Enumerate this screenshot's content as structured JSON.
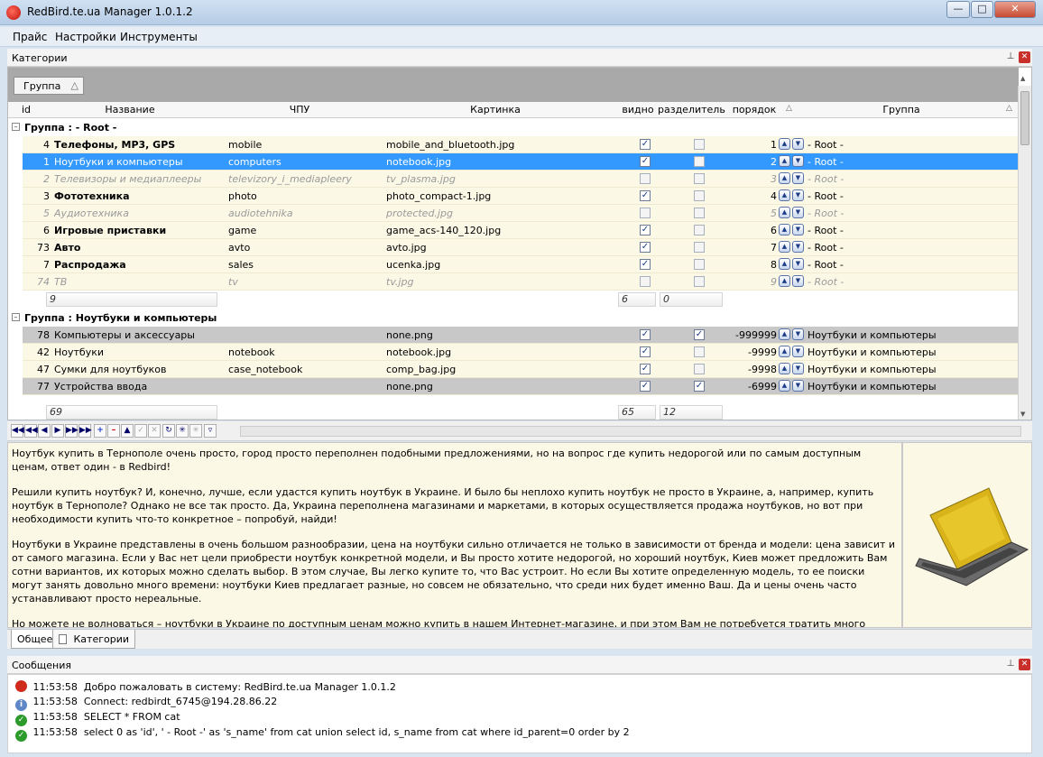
{
  "window": {
    "title": "RedBird.te.ua Manager 1.0.1.2"
  },
  "menu": [
    "Прайс",
    "Настройки",
    "Инструменты"
  ],
  "categories_panel": {
    "title": "Категории",
    "group_button": "Группа"
  },
  "columns": [
    "id",
    "Название",
    "ЧПУ",
    "Картинка",
    "видно",
    "разделитель",
    "порядок",
    "Группа"
  ],
  "group1": {
    "label": "Группа :  - Root -",
    "rows": [
      {
        "id": "4",
        "name": "Телефоны, MP3, GPS",
        "chpu": "mobile",
        "pic": "mobile_and_bluetooth.jpg",
        "visible": true,
        "sep": false,
        "order": "1",
        "group": "- Root -",
        "style": "bold"
      },
      {
        "id": "1",
        "name": "Ноутбуки и компьютеры",
        "chpu": "computers",
        "pic": "notebook.jpg",
        "visible": true,
        "sep": false,
        "order": "2",
        "group": "- Root -",
        "style": "sel"
      },
      {
        "id": "2",
        "name": "Телевизоры и медиаплееры",
        "chpu": "televizory_i_mediapleery",
        "pic": "tv_plasma.jpg",
        "visible": false,
        "sep": false,
        "order": "3",
        "group": "- Root -",
        "style": "dim"
      },
      {
        "id": "3",
        "name": "Фототехника",
        "chpu": "photo",
        "pic": "photo_compact-1.jpg",
        "visible": true,
        "sep": false,
        "order": "4",
        "group": "- Root -",
        "style": "bold"
      },
      {
        "id": "5",
        "name": "Аудиотехника",
        "chpu": "audiotehnika",
        "pic": "protected.jpg",
        "visible": false,
        "sep": false,
        "order": "5",
        "group": "- Root -",
        "style": "dim"
      },
      {
        "id": "6",
        "name": "Игровые приставки",
        "chpu": "game",
        "pic": "game_acs-140_120.jpg",
        "visible": true,
        "sep": false,
        "order": "6",
        "group": "- Root -",
        "style": "bold"
      },
      {
        "id": "73",
        "name": "Авто",
        "chpu": "avto",
        "pic": "avto.jpg",
        "visible": true,
        "sep": false,
        "order": "7",
        "group": "- Root -",
        "style": "bold"
      },
      {
        "id": "7",
        "name": "Распродажа",
        "chpu": "sales",
        "pic": "ucenka.jpg",
        "visible": true,
        "sep": false,
        "order": "8",
        "group": "- Root -",
        "style": "bold"
      },
      {
        "id": "74",
        "name": "ТВ",
        "chpu": "tv",
        "pic": "tv.jpg",
        "visible": false,
        "sep": false,
        "order": "9",
        "group": "- Root -",
        "style": "dim"
      }
    ],
    "footer": {
      "count": "9",
      "visible": "6",
      "sep": "0"
    }
  },
  "group2": {
    "label": "Группа : Ноутбуки и компьютеры",
    "rows": [
      {
        "id": "78",
        "name": "Компьютеры и аксессуары",
        "chpu": "",
        "pic": "none.png",
        "visible": true,
        "sep": true,
        "order": "-999999",
        "group": "Ноутбуки и компьютеры",
        "style": "alt"
      },
      {
        "id": "42",
        "name": "Ноутбуки",
        "chpu": "notebook",
        "pic": "notebook.jpg",
        "visible": true,
        "sep": false,
        "order": "-9999",
        "group": "Ноутбуки и компьютеры",
        "style": ""
      },
      {
        "id": "47",
        "name": "Сумки для ноутбуков",
        "chpu": "case_notebook",
        "pic": "comp_bag.jpg",
        "visible": true,
        "sep": false,
        "order": "-9998",
        "group": "Ноутбуки и компьютеры",
        "style": ""
      },
      {
        "id": "77",
        "name": "Устройства ввода",
        "chpu": "",
        "pic": "none.png",
        "visible": true,
        "sep": true,
        "order": "-6999",
        "group": "Ноутбуки и компьютеры",
        "style": "alt"
      }
    ],
    "footer": {
      "count": "69",
      "visible": "65",
      "sep": "12"
    }
  },
  "description": [
    "Ноутбук купить в Тернополе очень просто, город просто переполнен подобными предложениями, но на вопрос где купить недорогой или по самым доступным ценам, ответ один - в Redbird!",
    "Решили купить ноутбук? И, конечно, лучше, если удастся купить ноутбук в Украине. И было бы неплохо купить ноутбук не просто в Украине, а, например, купить ноутбук в Тернополе? Однако не все так просто. Да, Украина переполнена магазинами и маркетами, в которых осуществляется продажа ноутбуков, но вот при необходимости купить что-то конкретное – попробуй, найди!",
    "Ноутбуки в Украине представлены в очень большом разнообразии, цена на ноутбуки сильно отличается не только в зависимости от бренда и модели: цена зависит и от самого магазина. Если у Вас нет цели приобрести ноутбук конкретной модели, и Вы просто хотите недорогой, но хороший ноутбук, Киев может предложить Вам сотни вариантов, их которых можно сделать выбор. В этом случае, Вы легко купите то, что Вас устроит. Но если Вы хотите определенную модель, то ее поиски могут занять довольно много времени: ноутбуки Киев предлагает разные, но совсем не обязательно, что среди них будет именно Ваш. Да и цены очень часто устанавливают просто нереальные.",
    "Но можете не волноваться – ноутбуки в Украине по доступным ценам можно купить в нашем Интернет-магазине, и при этом Вам не потребуется тратить много времени на поиски нужной модели. Такой большой ассортимент моделей и цен Вы не увидите больше ни в одном магазине! Мечта купить ноутбук Asus? Хорошо! Популярнейшие модели данного изготовителя имеются в магазине FotoMag. Интересуетесь ноутбуками Toshiba, Samsung, или LG? И опять – заходите в Redbird! Наиболее современные, качественные, модные и восхитительные ноутбуки Вы"
  ],
  "tabs": [
    "Общее",
    "Категории"
  ],
  "messages_panel": {
    "title": "Сообщения"
  },
  "messages": [
    {
      "time": "11:53:58",
      "text": "Добро пожаловать в систему: RedBird.te.ua Manager 1.0.1.2",
      "icon": "app-icon"
    },
    {
      "time": "11:53:58",
      "text": "Connect: redbirdt_6745@194.28.86.22",
      "icon": "info-icon"
    },
    {
      "time": "11:53:58",
      "text": "SELECT * FROM cat",
      "icon": "ok-icon"
    },
    {
      "time": "11:53:58",
      "text": "select 0 as 'id', ' - Root -' as 's_name' from cat union select id, s_name  from cat where id_parent=0 order by 2",
      "icon": "ok-icon"
    }
  ]
}
